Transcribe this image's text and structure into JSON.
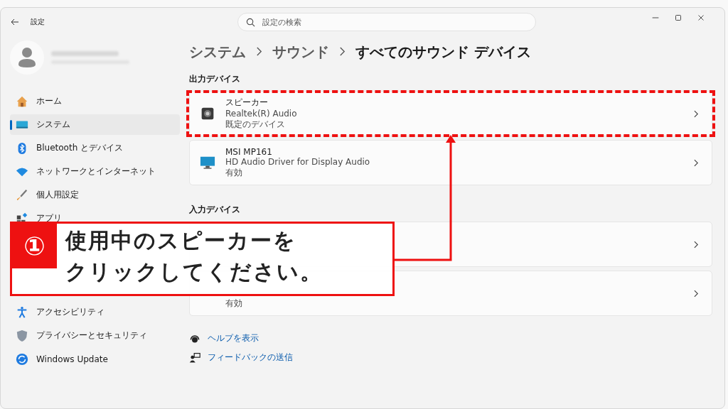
{
  "window": {
    "title": "設定",
    "search": {
      "placeholder": "設定の検索"
    }
  },
  "sidebar": {
    "items": [
      {
        "kind": "item",
        "label": "ホーム",
        "selected": false
      },
      {
        "kind": "item",
        "label": "システム",
        "selected": true
      },
      {
        "kind": "item",
        "label": "Bluetooth とデバイス",
        "selected": false
      },
      {
        "kind": "item",
        "label": "ネットワークとインターネット",
        "selected": false
      },
      {
        "kind": "item",
        "label": "個人用設定",
        "selected": false
      },
      {
        "kind": "item",
        "label": "アプリ",
        "selected": false
      },
      {
        "kind": "covered"
      },
      {
        "kind": "covered"
      },
      {
        "kind": "covered"
      },
      {
        "kind": "item",
        "label": "アクセシビリティ",
        "selected": false
      },
      {
        "kind": "item",
        "label": "プライバシーとセキュリティ",
        "selected": false
      },
      {
        "kind": "item",
        "label": "Windows Update",
        "selected": false
      }
    ]
  },
  "breadcrumb": [
    "システム",
    "サウンド",
    "すべてのサウンド デバイス"
  ],
  "sections": [
    {
      "heading": "出力デバイス",
      "devices": [
        {
          "name": "スピーカー",
          "driver": "Realtek(R) Audio",
          "status": "既定のデバイス",
          "highlighted": true
        },
        {
          "name": "MSI MP161",
          "driver": "HD Audio Driver for Display Audio",
          "status": "有効",
          "highlighted": false
        }
      ]
    },
    {
      "heading": "入力デバイス",
      "devices": [
        {
          "highlighted": false
        },
        {
          "status": "有効",
          "highlighted": false
        }
      ]
    }
  ],
  "links": [
    {
      "label": "ヘルプを表示"
    },
    {
      "label": "フィードバックの送信"
    }
  ],
  "callout": {
    "number": "①",
    "lines": [
      "使用中のスピーカーを",
      "クリックしてください。"
    ]
  }
}
